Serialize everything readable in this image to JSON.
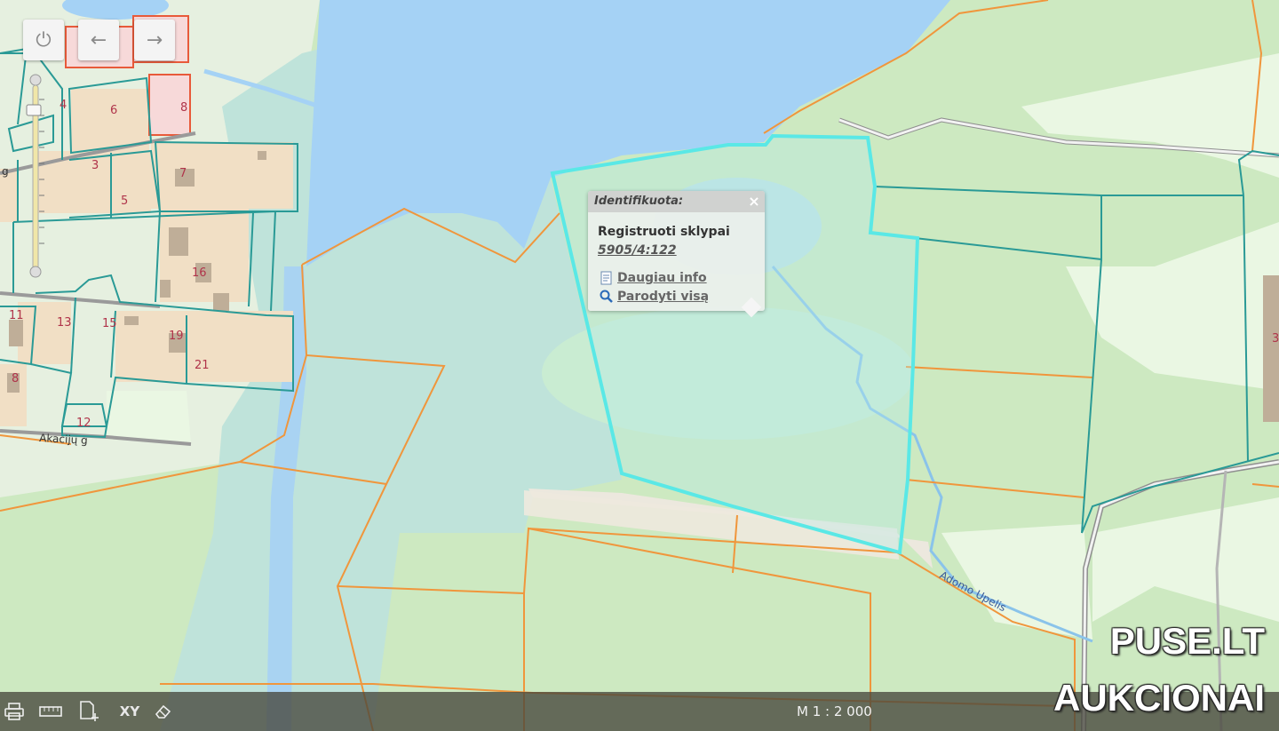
{
  "map": {
    "street_labels": [
      "Akacijų g",
      "g"
    ],
    "water_label": "Adomo Upelis",
    "parcel_numbers": [
      "6",
      "8",
      "4",
      "3",
      "7",
      "5",
      "16",
      "11",
      "13",
      "15",
      "19",
      "21",
      "8",
      "12"
    ],
    "right_edge_label": "3"
  },
  "controls": {
    "power_icon": "power-icon",
    "back_icon": "arrow-left-icon",
    "forward_icon": "arrow-right-icon"
  },
  "popup": {
    "title": "Identifikuota:",
    "close": "×",
    "layer": "Registruoti sklypai",
    "parcel_id": "5905/4:122",
    "more_info": "Daugiau info",
    "show_all": "Parodyti visą"
  },
  "toolbar": {
    "scale": "M 1 : 2 000",
    "tools": [
      "print-icon",
      "ruler-icon",
      "add-document-icon",
      "xy-icon",
      "eraser-icon"
    ],
    "xy_label": "XY"
  },
  "watermark": {
    "line1": "PUSE.LT",
    "line2": "AUKCIONAI"
  },
  "colors": {
    "water": "#a5d2f5",
    "forest": "#c4e6b4",
    "parcel_outline": "#2a9a96",
    "cadastre_outline": "#f0963c",
    "selection": "#5ae8e6"
  }
}
